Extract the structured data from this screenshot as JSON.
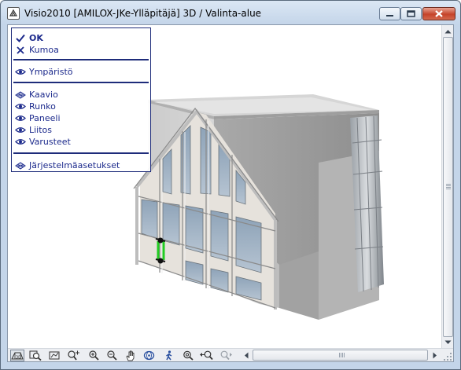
{
  "window": {
    "title": "Visio2010  [AMILOX-JKe-Ylläpitäjä] 3D / Valinta-alue",
    "controls": [
      "minimize-icon",
      "restore-icon",
      "close-icon"
    ]
  },
  "context_menu": {
    "items": [
      {
        "label": "OK",
        "icon": "check-icon",
        "bold": true
      },
      {
        "label": "Kumoa",
        "icon": "x-icon"
      },
      {
        "label": "Ympäristö",
        "icon": "eye-icon"
      },
      {
        "label": "Kaavio",
        "icon": "layers-icon"
      },
      {
        "label": "Runko",
        "icon": "eye-icon"
      },
      {
        "label": "Paneeli",
        "icon": "eye-icon"
      },
      {
        "label": "Liitos",
        "icon": "eye-icon"
      },
      {
        "label": "Varusteet",
        "icon": "eye-icon"
      },
      {
        "label": "Järjestelmäasetukset",
        "icon": "settings-icon"
      }
    ]
  },
  "toolbar": {
    "tools": [
      "3d-view-icon",
      "zoom-window-icon",
      "view-rotate-icon",
      "zoom-extents-icon",
      "zoom-in-icon",
      "zoom-out-icon",
      "pan-hand-icon",
      "orbit-icon",
      "walk-icon",
      "zoom-realtime-icon",
      "zoom-previous-icon",
      "zoom-next-icon"
    ]
  },
  "colors": {
    "menu_text": "#1c2a8c",
    "menu_border": "#1e2c7a",
    "selection_highlight": "#22cc22",
    "model_wall": "#c4c4c4"
  }
}
